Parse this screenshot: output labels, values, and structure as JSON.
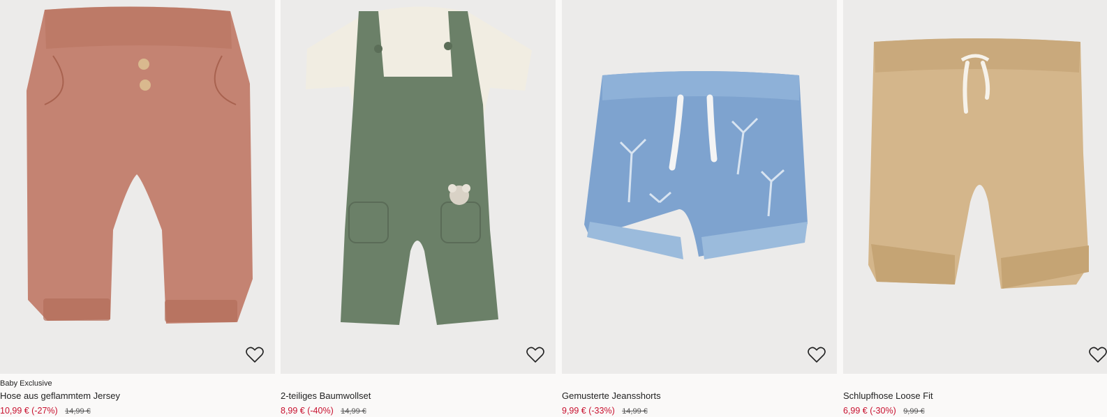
{
  "products": [
    {
      "label": "Baby Exclusive",
      "title": "Hose aus geflammtem Jersey",
      "sale_price": "10,99 € (-27%)",
      "original_price": "14,99 €",
      "color": "#c48372"
    },
    {
      "label": "",
      "title": "2-teiliges Baumwollset",
      "sale_price": "8,99 € (-40%)",
      "original_price": "14,99 €",
      "color": "#6b8068"
    },
    {
      "label": "",
      "title": "Gemusterte Jeansshorts",
      "sale_price": "9,99 € (-33%)",
      "original_price": "14,99 €",
      "color": "#7ea3cf"
    },
    {
      "label": "",
      "title": "Schlupfhose Loose Fit",
      "sale_price": "6,99 € (-30%)",
      "original_price": "9,99 €",
      "color": "#d4b68b"
    }
  ],
  "icons": {
    "favorite": "heart-outline-icon"
  },
  "colors": {
    "sale_price": "#c8102e",
    "image_background": "#ecebea"
  }
}
